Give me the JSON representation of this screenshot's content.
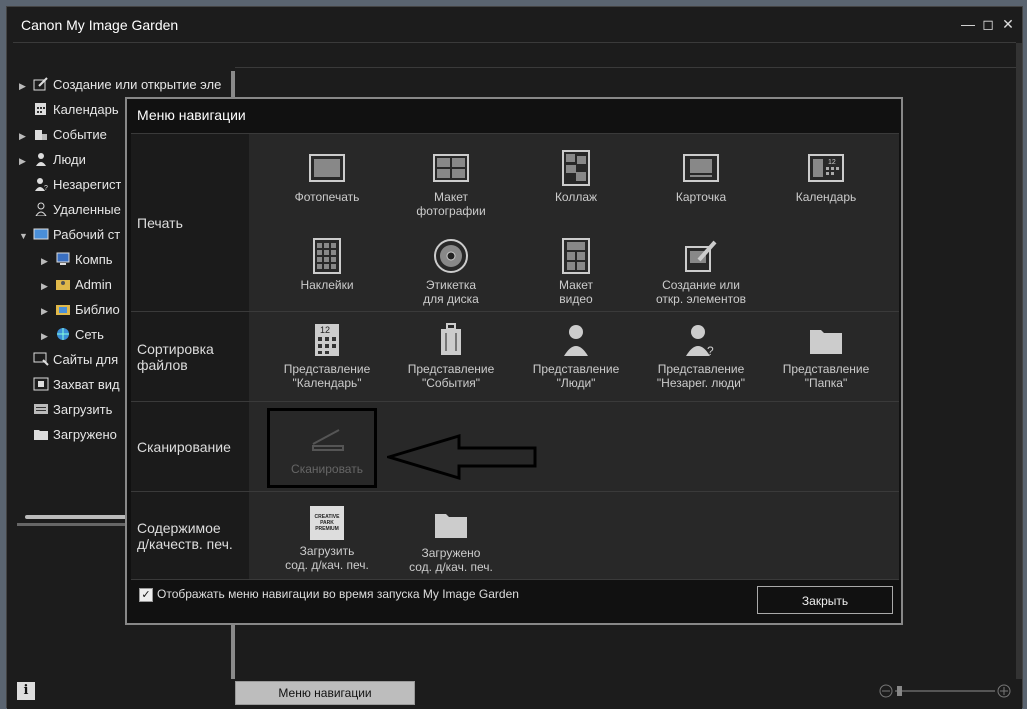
{
  "window": {
    "title": "Canon My Image Garden",
    "minimize_icon": "minimize-icon",
    "maximize_icon": "maximize-icon",
    "close_icon": "close-icon"
  },
  "sidebar": {
    "items": [
      {
        "label": "Создание или открытие эле",
        "icon": "create-icon"
      },
      {
        "label": "Календарь",
        "icon": "calendar-icon"
      },
      {
        "label": "Событие",
        "icon": "event-icon"
      },
      {
        "label": "Люди",
        "icon": "person-icon"
      },
      {
        "label": "Незарегист",
        "icon": "unregistered-person-icon"
      },
      {
        "label": "Удаленные",
        "icon": "deleted-person-icon"
      },
      {
        "label": "Рабочий ст",
        "icon": "desktop-icon"
      },
      {
        "label": "Компь",
        "icon": "computer-icon"
      },
      {
        "label": "Admin",
        "icon": "user-folder-icon"
      },
      {
        "label": "Библио",
        "icon": "library-icon"
      },
      {
        "label": "Сеть",
        "icon": "network-icon"
      },
      {
        "label": "Сайты для",
        "icon": "sites-icon"
      },
      {
        "label": "Захват вид",
        "icon": "video-capture-icon"
      },
      {
        "label": "Загрузить",
        "icon": "download-icon"
      },
      {
        "label": "Загружено",
        "icon": "folder-icon"
      }
    ]
  },
  "bottom": {
    "navmenu_label": "Меню навигации",
    "info_label": "i"
  },
  "dialog": {
    "title": "Меню навигации",
    "sections": {
      "print": {
        "label": "Печать",
        "tiles": [
          {
            "label1": "Фотопечать",
            "label2": ""
          },
          {
            "label1": "Макет",
            "label2": "фотографии"
          },
          {
            "label1": "Коллаж",
            "label2": ""
          },
          {
            "label1": "Карточка",
            "label2": ""
          },
          {
            "label1": "Календарь",
            "label2": ""
          },
          {
            "label1": "Наклейки",
            "label2": ""
          },
          {
            "label1": "Этикетка",
            "label2": "для диска"
          },
          {
            "label1": "Макет",
            "label2": "видео"
          },
          {
            "label1": "Создание или",
            "label2": "откр. элементов"
          }
        ]
      },
      "sort": {
        "label1": "Сортировка",
        "label2": "файлов",
        "tiles": [
          {
            "label1": "Представление",
            "label2": "\"Календарь\""
          },
          {
            "label1": "Представление",
            "label2": "\"События\""
          },
          {
            "label1": "Представление",
            "label2": "\"Люди\""
          },
          {
            "label1": "Представление",
            "label2": "\"Незарег. люди\""
          },
          {
            "label1": "Представление",
            "label2": "\"Папка\""
          }
        ]
      },
      "scan": {
        "label": "Сканирование",
        "tile_label": "Сканировать"
      },
      "content": {
        "label1": "Содержимое",
        "label2": "д/качеств. печ.",
        "creative_park_text": "CREATIVE PARK PREMIUM",
        "tiles": [
          {
            "label1": "Загрузить",
            "label2": "сод. д/кач. печ."
          },
          {
            "label1": "Загружено",
            "label2": "сод. д/кач. печ."
          }
        ]
      }
    },
    "footer": {
      "checkbox_checked": true,
      "checkbox_label": "Отображать меню навигации во время запуска My Image Garden",
      "close_label": "Закрыть"
    }
  }
}
